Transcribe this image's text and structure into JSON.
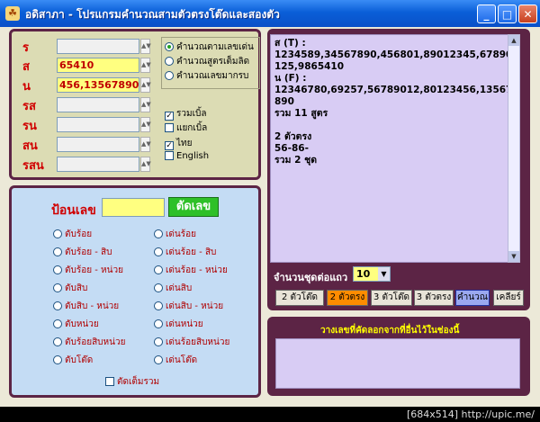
{
  "window": {
    "title": "อดิสาภา - โปรแกรมคำนวณสามตัวตรงโต๊ดและสองตัว",
    "icon_glyph": "☘",
    "min_glyph": "_",
    "max_glyph": "□",
    "close_glyph": "✕"
  },
  "inputs": [
    {
      "label": "ร",
      "value": ""
    },
    {
      "label": "ส",
      "value": "65410"
    },
    {
      "label": "น",
      "value": "456,13567890"
    },
    {
      "label": "รส",
      "value": ""
    },
    {
      "label": "รน",
      "value": ""
    },
    {
      "label": "สน",
      "value": ""
    },
    {
      "label": "รสน",
      "value": ""
    }
  ],
  "calc_modes": [
    {
      "label": "คำนวณตามเลขเด่น",
      "selected": true
    },
    {
      "label": "คำนวณสูตรเต็มลิด",
      "selected": false
    },
    {
      "label": "คำนวณเลขมากรบ",
      "selected": false
    }
  ],
  "group_opts": [
    {
      "label": "รวมเบิ้ล",
      "checked": true
    },
    {
      "label": "แยกเบิ้ล",
      "checked": false
    }
  ],
  "lang_opts": [
    {
      "label": "ไทย",
      "checked": true
    },
    {
      "label": "English",
      "checked": false
    }
  ],
  "cut": {
    "input_label": "ป้อนเลข",
    "input_value": "",
    "cut_button": "ตัดเลข",
    "left_options": [
      "ตับร้อย",
      "ตับร้อย - สิบ",
      "ตับร้อย - หน่วย",
      "ตับสิบ",
      "ตับสิบ - หน่วย",
      "ตับหน่วย",
      "ตับร้อยสิบหน่วย",
      "ตับโต๊ด"
    ],
    "right_options": [
      "เด่นร้อย",
      "เด่นร้อย - สิบ",
      "เด่นร้อย - หน่วย",
      "เด่นสิบ",
      "เด่นสิบ - หน่วย",
      "เด่นหน่วย",
      "เด่นร้อยสิบหน่วย",
      "เด่นโต๊ด"
    ],
    "bottom_check": "ตัดเต็มรวม"
  },
  "result": {
    "lines": [
      "ส (T) :",
      "1234589,34567890,456801,89012345,67890125,9865410",
      "น (F) :",
      "12346780,69257,56789012,80123456,13567890",
      "รวม 11 สูตร",
      "",
      "2 ตัวตรง",
      "56-86-",
      "รวม 2 ชุด"
    ]
  },
  "per_row": {
    "label": "จำนวนชุดต่อแถว",
    "value": "10"
  },
  "tabs": [
    {
      "label": "2 ตัวโต๊ด",
      "state": "normal"
    },
    {
      "label": "2 ตัวตรง",
      "state": "orange"
    },
    {
      "label": "3 ตัวโต๊ด",
      "state": "normal"
    },
    {
      "label": "3 ตัวตรง",
      "state": "normal"
    },
    {
      "label": "คำนวณ",
      "state": "selected"
    },
    {
      "label": "เคลียร์",
      "state": "normal"
    }
  ],
  "paste": {
    "label": "วางเลขที่คัดลอกจากที่อื่นไว้ในช่องนี้",
    "value": ""
  },
  "footer": "[684x514] http://upic.me/"
}
